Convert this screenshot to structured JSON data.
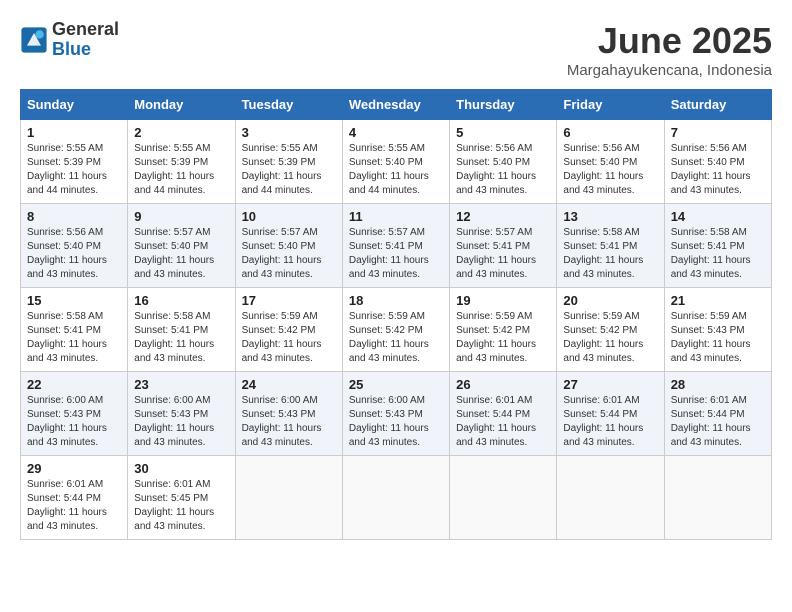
{
  "header": {
    "logo_general": "General",
    "logo_blue": "Blue",
    "title": "June 2025",
    "subtitle": "Margahayukencana, Indonesia"
  },
  "calendar": {
    "days_of_week": [
      "Sunday",
      "Monday",
      "Tuesday",
      "Wednesday",
      "Thursday",
      "Friday",
      "Saturday"
    ],
    "weeks": [
      [
        {
          "day": "1",
          "info": "Sunrise: 5:55 AM\nSunset: 5:39 PM\nDaylight: 11 hours and 44 minutes."
        },
        {
          "day": "2",
          "info": "Sunrise: 5:55 AM\nSunset: 5:39 PM\nDaylight: 11 hours and 44 minutes."
        },
        {
          "day": "3",
          "info": "Sunrise: 5:55 AM\nSunset: 5:39 PM\nDaylight: 11 hours and 44 minutes."
        },
        {
          "day": "4",
          "info": "Sunrise: 5:55 AM\nSunset: 5:40 PM\nDaylight: 11 hours and 44 minutes."
        },
        {
          "day": "5",
          "info": "Sunrise: 5:56 AM\nSunset: 5:40 PM\nDaylight: 11 hours and 43 minutes."
        },
        {
          "day": "6",
          "info": "Sunrise: 5:56 AM\nSunset: 5:40 PM\nDaylight: 11 hours and 43 minutes."
        },
        {
          "day": "7",
          "info": "Sunrise: 5:56 AM\nSunset: 5:40 PM\nDaylight: 11 hours and 43 minutes."
        }
      ],
      [
        {
          "day": "8",
          "info": "Sunrise: 5:56 AM\nSunset: 5:40 PM\nDaylight: 11 hours and 43 minutes."
        },
        {
          "day": "9",
          "info": "Sunrise: 5:57 AM\nSunset: 5:40 PM\nDaylight: 11 hours and 43 minutes."
        },
        {
          "day": "10",
          "info": "Sunrise: 5:57 AM\nSunset: 5:40 PM\nDaylight: 11 hours and 43 minutes."
        },
        {
          "day": "11",
          "info": "Sunrise: 5:57 AM\nSunset: 5:41 PM\nDaylight: 11 hours and 43 minutes."
        },
        {
          "day": "12",
          "info": "Sunrise: 5:57 AM\nSunset: 5:41 PM\nDaylight: 11 hours and 43 minutes."
        },
        {
          "day": "13",
          "info": "Sunrise: 5:58 AM\nSunset: 5:41 PM\nDaylight: 11 hours and 43 minutes."
        },
        {
          "day": "14",
          "info": "Sunrise: 5:58 AM\nSunset: 5:41 PM\nDaylight: 11 hours and 43 minutes."
        }
      ],
      [
        {
          "day": "15",
          "info": "Sunrise: 5:58 AM\nSunset: 5:41 PM\nDaylight: 11 hours and 43 minutes."
        },
        {
          "day": "16",
          "info": "Sunrise: 5:58 AM\nSunset: 5:41 PM\nDaylight: 11 hours and 43 minutes."
        },
        {
          "day": "17",
          "info": "Sunrise: 5:59 AM\nSunset: 5:42 PM\nDaylight: 11 hours and 43 minutes."
        },
        {
          "day": "18",
          "info": "Sunrise: 5:59 AM\nSunset: 5:42 PM\nDaylight: 11 hours and 43 minutes."
        },
        {
          "day": "19",
          "info": "Sunrise: 5:59 AM\nSunset: 5:42 PM\nDaylight: 11 hours and 43 minutes."
        },
        {
          "day": "20",
          "info": "Sunrise: 5:59 AM\nSunset: 5:42 PM\nDaylight: 11 hours and 43 minutes."
        },
        {
          "day": "21",
          "info": "Sunrise: 5:59 AM\nSunset: 5:43 PM\nDaylight: 11 hours and 43 minutes."
        }
      ],
      [
        {
          "day": "22",
          "info": "Sunrise: 6:00 AM\nSunset: 5:43 PM\nDaylight: 11 hours and 43 minutes."
        },
        {
          "day": "23",
          "info": "Sunrise: 6:00 AM\nSunset: 5:43 PM\nDaylight: 11 hours and 43 minutes."
        },
        {
          "day": "24",
          "info": "Sunrise: 6:00 AM\nSunset: 5:43 PM\nDaylight: 11 hours and 43 minutes."
        },
        {
          "day": "25",
          "info": "Sunrise: 6:00 AM\nSunset: 5:43 PM\nDaylight: 11 hours and 43 minutes."
        },
        {
          "day": "26",
          "info": "Sunrise: 6:01 AM\nSunset: 5:44 PM\nDaylight: 11 hours and 43 minutes."
        },
        {
          "day": "27",
          "info": "Sunrise: 6:01 AM\nSunset: 5:44 PM\nDaylight: 11 hours and 43 minutes."
        },
        {
          "day": "28",
          "info": "Sunrise: 6:01 AM\nSunset: 5:44 PM\nDaylight: 11 hours and 43 minutes."
        }
      ],
      [
        {
          "day": "29",
          "info": "Sunrise: 6:01 AM\nSunset: 5:44 PM\nDaylight: 11 hours and 43 minutes."
        },
        {
          "day": "30",
          "info": "Sunrise: 6:01 AM\nSunset: 5:45 PM\nDaylight: 11 hours and 43 minutes."
        },
        {
          "day": "",
          "info": ""
        },
        {
          "day": "",
          "info": ""
        },
        {
          "day": "",
          "info": ""
        },
        {
          "day": "",
          "info": ""
        },
        {
          "day": "",
          "info": ""
        }
      ]
    ]
  }
}
